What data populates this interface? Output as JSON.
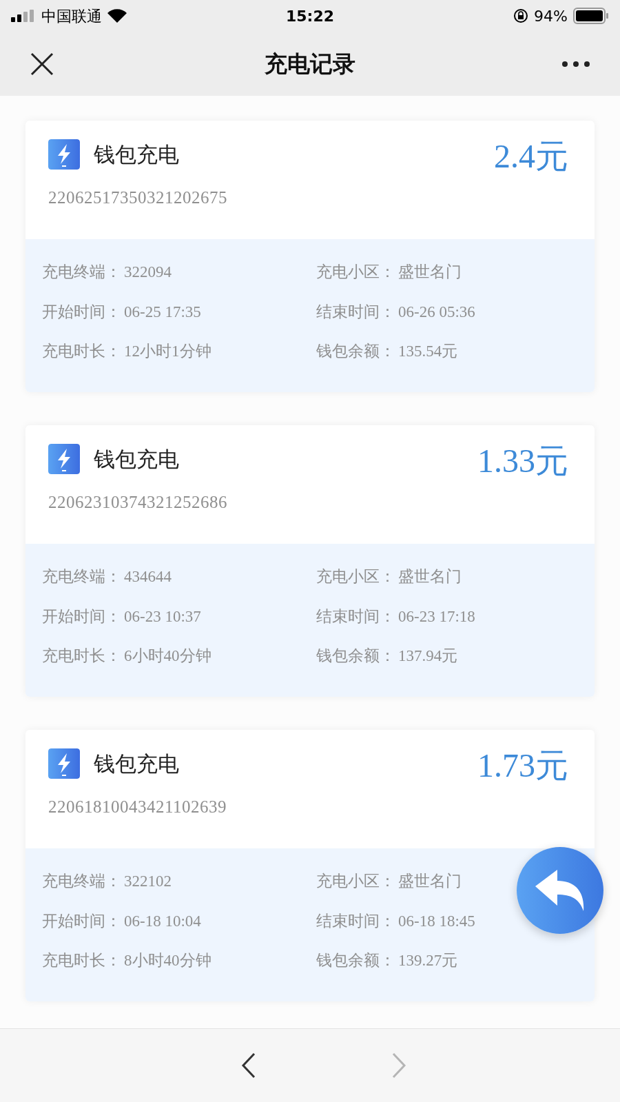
{
  "status_bar": {
    "carrier": "中国联通",
    "time": "15:22",
    "battery": "94%"
  },
  "nav": {
    "title": "充电记录"
  },
  "records": [
    {
      "type": "钱包充电",
      "amount": "2.4元",
      "order_no": "22062517350321202675",
      "fields": [
        {
          "label": "充电终端：",
          "value": "322094"
        },
        {
          "label": "充电小区：",
          "value": "盛世名门"
        },
        {
          "label": "开始时间：",
          "value": "06-25 17:35"
        },
        {
          "label": "结束时间：",
          "value": "06-26 05:36"
        },
        {
          "label": "充电时长：",
          "value": "12小时1分钟"
        },
        {
          "label": "钱包余额：",
          "value": "135.54元"
        }
      ]
    },
    {
      "type": "钱包充电",
      "amount": "1.33元",
      "order_no": "22062310374321252686",
      "fields": [
        {
          "label": "充电终端：",
          "value": "434644"
        },
        {
          "label": "充电小区：",
          "value": "盛世名门"
        },
        {
          "label": "开始时间：",
          "value": "06-23 10:37"
        },
        {
          "label": "结束时间：",
          "value": "06-23 17:18"
        },
        {
          "label": "充电时长：",
          "value": "6小时40分钟"
        },
        {
          "label": "钱包余额：",
          "value": "137.94元"
        }
      ]
    },
    {
      "type": "钱包充电",
      "amount": "1.73元",
      "order_no": "22061810043421102639",
      "fields": [
        {
          "label": "充电终端：",
          "value": "322102"
        },
        {
          "label": "充电小区：",
          "value": "盛世名门"
        },
        {
          "label": "开始时间：",
          "value": "06-18 10:04"
        },
        {
          "label": "结束时间：",
          "value": "06-18 18:45"
        },
        {
          "label": "充电时长：",
          "value": "8小时40分钟"
        },
        {
          "label": "钱包余额：",
          "value": "139.27元"
        }
      ]
    }
  ],
  "toolbar": {
    "back": {
      "disabled": false
    },
    "forward": {
      "disabled": true
    }
  }
}
